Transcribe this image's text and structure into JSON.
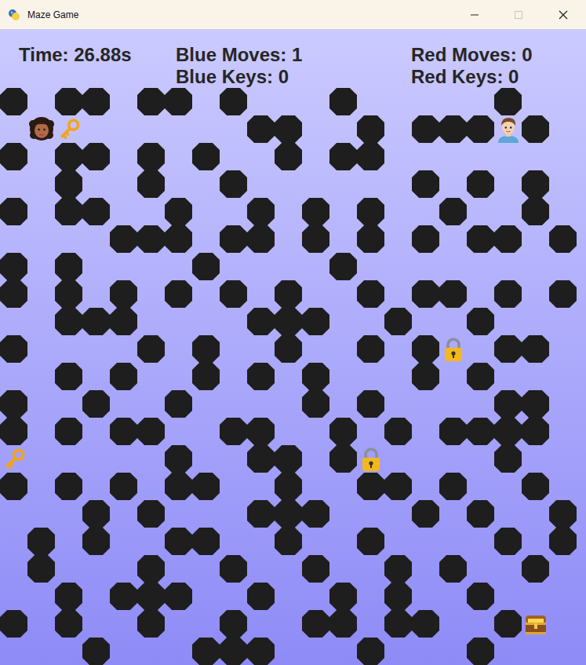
{
  "window": {
    "title": "Maze Game",
    "maximize_enabled": false
  },
  "hud": {
    "time": "Time: 26.88s",
    "blue": {
      "moves": "Blue Moves: 1",
      "keys": "Blue Keys: 0"
    },
    "red": {
      "moves": "Red Moves: 0",
      "keys": "Red Keys: 0"
    }
  },
  "maze": {
    "rows": [
      "#.##.##.#...#.....#..",
      ".BK......##..#.###R#.",
      "#.##.#.#..#.##.......",
      "..#..#..#......#.#.#.",
      "#.##..#..#.#.#..#..#.",
      "....###.##.#.#.#.##.#",
      "#.#....#....#........",
      "#.#.#.#.#.#..#.##.#.#",
      "..###....###..#..#...",
      "#....#.#..#..#.#L.##.",
      "..#.#..#.#.#...#.#...",
      "#..#..#....#.#....##.",
      "#.#.##..##..#.#.####.",
      "K.....#..##.#L....#..",
      "#.#.#.##..#..##.#..#.",
      "...#.#...###...#.#..#",
      ".#.#..##..#..#....#.#",
      ".#...#..#..#..#.#..#.",
      "..#.###..#..#.#..#...",
      "#.#..#..#..##.##..#T.",
      "...#...###...#...#..."
    ]
  }
}
